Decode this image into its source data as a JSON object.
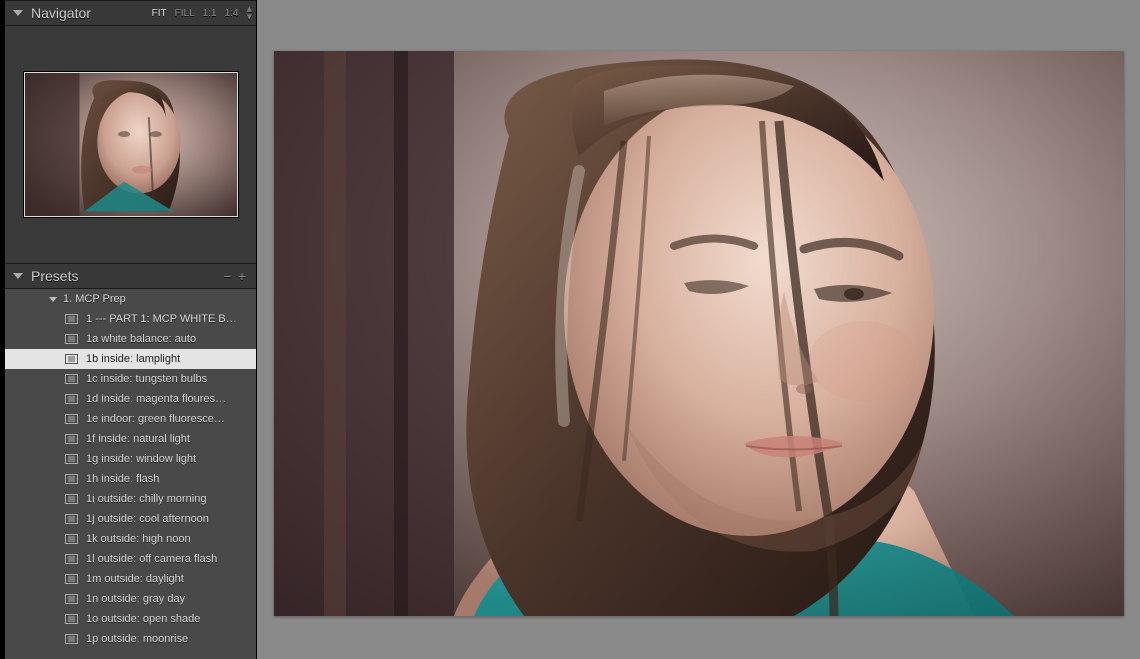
{
  "navigator": {
    "title": "Navigator",
    "zoom_fit": "FIT",
    "zoom_fill": "FILL",
    "zoom_1_1": "1:1",
    "zoom_1_4": "1:4"
  },
  "presets": {
    "title": "Presets",
    "folder": "1. MCP Prep",
    "selected_index": 2,
    "items": [
      "1 --- PART 1: MCP WHITE B…",
      "1a white balance: auto",
      "1b inside: lamplight",
      "1c inside: tungsten bulbs",
      "1d inside: magenta floures…",
      "1e indoor: green fluoresce…",
      "1f inside: natural light",
      "1g inside: window light",
      "1h inside: flash",
      "1i outside: chilly morning",
      "1j outside: cool afternoon",
      "1k outside: high noon",
      "1l outside:  off camera flash",
      "1m outside: daylight",
      "1n outside: gray day",
      "1o outside: open shade",
      "1p outside: moonrise"
    ]
  }
}
